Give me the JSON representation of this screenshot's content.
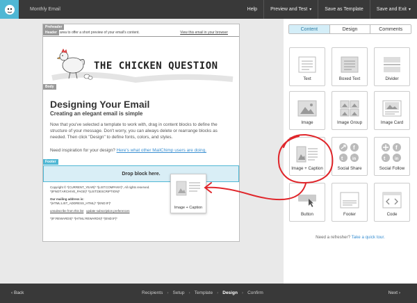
{
  "app": {
    "title": "Monthly Email"
  },
  "topnav": {
    "help": "Help",
    "preview": "Preview and Test",
    "save_template": "Save as Template",
    "save_exit": "Save and Exit"
  },
  "email": {
    "tags": {
      "preheader": "Preheader",
      "header": "Header",
      "body": "Body",
      "footer": "Footer"
    },
    "preheader_text": "area to offer a short preview of your email's content.",
    "preheader_link": "View this email in your browser",
    "banner_title": "THE CHICKEN QUESTION",
    "heading": "Designing Your Email",
    "subheading": "Creating an elegant email is simple",
    "paragraph": "Now that you've selected a template to work with, drag in content blocks to define the structure of your message. Don't worry, you can always delete or rearrange blocks as needed. Then click \"Design\" to define fonts, colors, and styles.",
    "inspire_text": "Need inspiration for your design?",
    "inspire_link": "Here's what other MailChimp users are doing.",
    "drop_zone": "Drop block here.",
    "footer": {
      "line1": "Copyright © *|CURRENT_YEAR|* *|LIST:COMPANY|*, All rights reserved.",
      "line2": "*|IFNOT:ARCHIVE_PAGE|* *|LIST:DESCRIPTION|*",
      "mailing_label": "Our mailing address is:",
      "mailing_value": "*|HTML:LIST_ADDRESS_HTML|* *|END:IF|*",
      "unsubscribe": "unsubscribe from this list",
      "update_prefs": "update subscription preferences",
      "rewards": "*|IF:REWARDS|* *|HTML:REWARDS|* *|END:IF|*"
    },
    "drag_card_label": "Image + Caption"
  },
  "panel": {
    "tabs": [
      "Content",
      "Design",
      "Comments"
    ],
    "blocks": [
      {
        "label": "Text",
        "icon": "text-block-icon"
      },
      {
        "label": "Boxed Text",
        "icon": "boxed-text-icon"
      },
      {
        "label": "Divider",
        "icon": "divider-icon"
      },
      {
        "label": "Image",
        "icon": "image-icon"
      },
      {
        "label": "Image Group",
        "icon": "image-group-icon"
      },
      {
        "label": "Image Card",
        "icon": "image-card-icon"
      },
      {
        "label": "Image + Caption",
        "icon": "image-caption-icon"
      },
      {
        "label": "Social Share",
        "icon": "social-share-icon"
      },
      {
        "label": "Social Follow",
        "icon": "social-follow-icon"
      },
      {
        "label": "Button",
        "icon": "button-icon"
      },
      {
        "label": "Footer",
        "icon": "footer-icon"
      },
      {
        "label": "Code",
        "icon": "code-icon"
      }
    ],
    "refresher_text": "Need a refresher?",
    "refresher_link": "Take a quick tour."
  },
  "bottombar": {
    "back": "Back",
    "next": "Next",
    "steps": [
      "Recipients",
      "Setup",
      "Template",
      "Design",
      "Confirm"
    ],
    "active_step": "Design"
  },
  "colors": {
    "accent": "#4fb7d4",
    "annotation": "#e0262b",
    "active_tab_bg": "#d4eef8"
  }
}
